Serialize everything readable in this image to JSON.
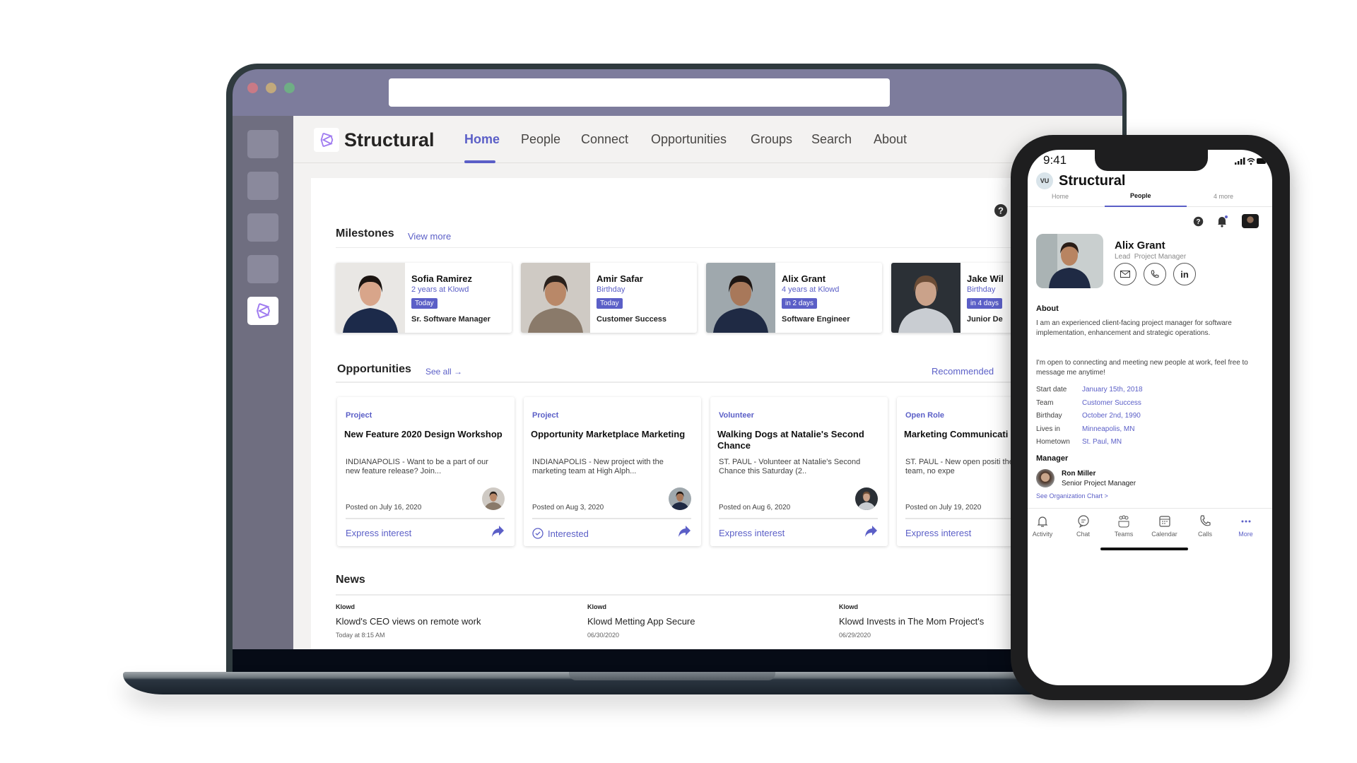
{
  "colors": {
    "accent": "#5b5fc7",
    "titlebar": "#7d7c9c",
    "rail": "#6f6e80",
    "traffic": [
      "#c97a86",
      "#c2a97c",
      "#6fae85"
    ]
  },
  "app": {
    "name": "Structural",
    "nav": [
      "Home",
      "People",
      "Connect",
      "Opportunities",
      "Groups",
      "Search",
      "About"
    ],
    "active_nav": "Home"
  },
  "milestones": {
    "title": "Milestones",
    "link": "View more",
    "items": [
      {
        "name": "Sofia Ramirez",
        "subtitle": "2 years at Klowd",
        "badge": "Today",
        "role": "Sr. Software Manager"
      },
      {
        "name": "Amir Safar",
        "subtitle": "Birthday",
        "badge": "Today",
        "role": "Customer Success"
      },
      {
        "name": "Alix Grant",
        "subtitle": "4 years at Klowd",
        "badge": "in 2 days",
        "role": "Software Engineer"
      },
      {
        "name": "Jake Wil",
        "subtitle": "Birthday",
        "badge": "in 4 days",
        "role": "Junior De"
      }
    ]
  },
  "opportunities": {
    "title": "Opportunities",
    "link": "See all",
    "filter": "Recommended",
    "items": [
      {
        "type": "Project",
        "title": "New Feature 2020 Design Workshop",
        "desc": "INDIANAPOLIS - Want to be a part of our new feature release? Join...",
        "posted": "Posted on July  16, 2020",
        "action": "Express interest",
        "interested": false
      },
      {
        "type": "Project",
        "title": "Opportunity Marketplace Marketing",
        "desc": "INDIANAPOLIS - New project with the marketing team at High Alph...",
        "posted": "Posted on Aug 3, 2020",
        "action": "Interested",
        "interested": true
      },
      {
        "type": "Volunteer",
        "title": "Walking Dogs at Natalie's Second Chance",
        "desc": "ST. PAUL - Volunteer at Natalie's Second Chance this Saturday (2..",
        "posted": "Posted on Aug 6, 2020",
        "action": "Express interest",
        "interested": false
      },
      {
        "type": "Open Role",
        "title": "Marketing Communicati Specialist",
        "desc": "ST. PAUL - New open positi the marketing team, no expe",
        "posted": "Posted on July 19, 2020",
        "action": "Express interest",
        "interested": false
      }
    ]
  },
  "news": {
    "title": "News",
    "items": [
      {
        "source": "Klowd",
        "title": "Klowd's CEO views on remote work",
        "date": "Today at 8:15 AM"
      },
      {
        "source": "Klowd",
        "title": "Klowd Metting App Secure",
        "date": "06/30/2020"
      },
      {
        "source": "Klowd",
        "title": "Klowd Invests in The Mom Project's",
        "date": "06/29/2020"
      }
    ]
  },
  "phone": {
    "time": "9:41",
    "avatar_initials": "VU",
    "app_name": "Structural",
    "tabs": [
      "Home",
      "People",
      "4 more"
    ],
    "active_tab": "People",
    "profile": {
      "name": "Alix Grant",
      "title": "Lead  Project Manager",
      "linkedin": "in"
    },
    "about_title": "About",
    "about": [
      "I am an experienced client-facing project manager for software implementation, enhancement and strategic operations.",
      "I'm open to connecting and meeting new people at work, feel free to message me anytime!"
    ],
    "fields": [
      {
        "label": "Start date",
        "value": "January 15th, 2018"
      },
      {
        "label": "Team",
        "value": "Customer Success"
      },
      {
        "label": "Birthday",
        "value": "October 2nd, 1990"
      },
      {
        "label": "Lives in",
        "value": "Minneapolis, MN"
      },
      {
        "label": "Hometown",
        "value": "St. Paul, MN"
      }
    ],
    "manager_title": "Manager",
    "manager": {
      "name": "Ron Miller",
      "role": "Senior Project Manager"
    },
    "org_link": "See Organization Chart >",
    "bottom_tabs": [
      "Activity",
      "Chat",
      "Teams",
      "Calendar",
      "Calls",
      "More"
    ],
    "active_bottom_tab": "More"
  }
}
